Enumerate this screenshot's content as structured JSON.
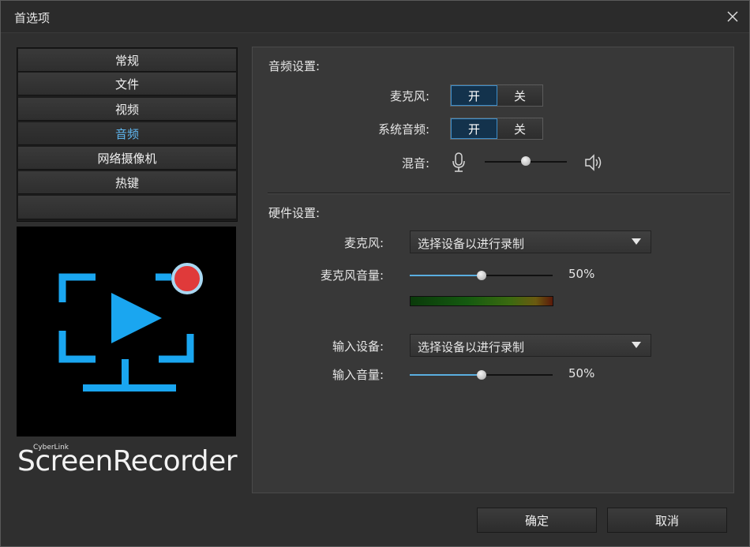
{
  "window": {
    "title": "首选项"
  },
  "nav": {
    "items": [
      {
        "label": "常规"
      },
      {
        "label": "文件"
      },
      {
        "label": "视频"
      },
      {
        "label": "音频"
      },
      {
        "label": "网络摄像机"
      },
      {
        "label": "热键"
      }
    ],
    "active": "音频"
  },
  "brand": {
    "small": "CyberLink",
    "name": "ScreenRecorder"
  },
  "audio": {
    "section_title": "音频设置:",
    "mic_label": "麦克风:",
    "system_label": "系统音频:",
    "mix_label": "混音:",
    "on_label": "开",
    "off_label": "关",
    "mic_state": "on",
    "system_state": "on",
    "mix_level": 0.5
  },
  "hardware": {
    "section_title": "硬件设置:",
    "mic_device_label": "麦克风:",
    "mic_device_value": "选择设备以进行录制",
    "mic_volume_label": "麦克风音量:",
    "mic_volume": "50%",
    "mic_volume_level": 0.5,
    "input_device_label": "输入设备:",
    "input_device_value": "选择设备以进行录制",
    "input_volume_label": "输入音量:",
    "input_volume": "50%",
    "input_volume_level": 0.5
  },
  "buttons": {
    "ok": "确定",
    "cancel": "取消"
  },
  "colors": {
    "accent": "#5fb6ef",
    "logo_blue": "#1aa6f0",
    "record_red": "#e03a3a"
  },
  "icons": [
    "close-icon",
    "microphone-icon",
    "speaker-icon",
    "chevron-down-icon"
  ]
}
